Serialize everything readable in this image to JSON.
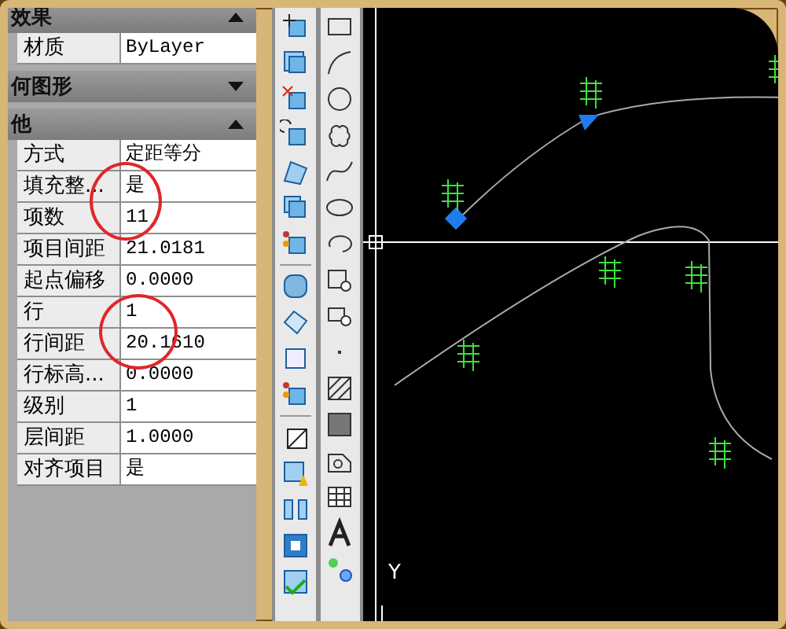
{
  "properties_panel": {
    "sections": [
      {
        "title": "效果",
        "expanded": true,
        "rows": [
          {
            "label": "材质",
            "value": "ByLayer"
          }
        ]
      },
      {
        "title": "何图形",
        "expanded": false
      },
      {
        "title": "他",
        "expanded": true,
        "rows": [
          {
            "label": "方式",
            "value": "定距等分"
          },
          {
            "label": "填充整...",
            "value": "是"
          },
          {
            "label": "项数",
            "value": "11"
          },
          {
            "label": "项目间距",
            "value": "21.0181"
          },
          {
            "label": "起点偏移",
            "value": "0.0000"
          },
          {
            "label": "行",
            "value": "1"
          },
          {
            "label": "行间距",
            "value": "20.1610"
          },
          {
            "label": "行标高...",
            "value": "0.0000"
          },
          {
            "label": "级别",
            "value": "1"
          },
          {
            "label": "层间距",
            "value": "1.0000"
          },
          {
            "label": "对齐项目",
            "value": "是"
          }
        ]
      }
    ]
  },
  "canvas": {
    "axis_label": "Y"
  }
}
